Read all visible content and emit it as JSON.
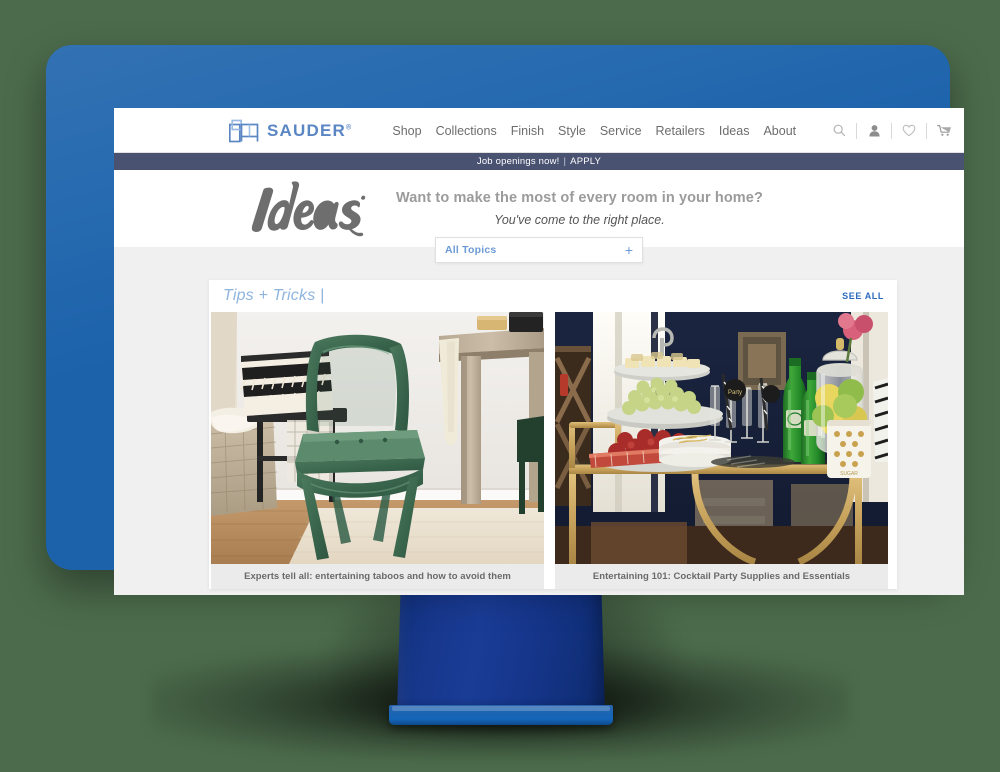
{
  "background_color": "#4c6b4c",
  "monitor": {
    "bezel_color": "#1b62ab",
    "stand_color": "#17378c",
    "stand_base_color": "#1565b8"
  },
  "site": {
    "brand": {
      "name": "SAUDER",
      "registered_mark": "®",
      "logo_icon": "sauder-furniture-logo-icon",
      "color": "#5b86c4"
    },
    "nav": [
      {
        "label": "Shop"
      },
      {
        "label": "Collections"
      },
      {
        "label": "Finish"
      },
      {
        "label": "Style"
      },
      {
        "label": "Service"
      },
      {
        "label": "Retailers"
      },
      {
        "label": "Ideas"
      },
      {
        "label": "About"
      }
    ],
    "header_icons": [
      {
        "name": "search-icon"
      },
      {
        "name": "account-icon"
      },
      {
        "name": "wishlist-heart-icon"
      },
      {
        "name": "shopping-cart-icon"
      }
    ],
    "announcement": {
      "text": "Job openings now!",
      "separator": "|",
      "link_label": "APPLY",
      "background_color": "#4a5272"
    },
    "hero": {
      "logo_word": "Ideas",
      "headline": "Want to make the most of every room in your home?",
      "subhead": "You've come to the right place."
    },
    "topics_filter": {
      "label": "All Topics",
      "expand_icon": "plus-icon",
      "accent_color": "#6b9ad4"
    },
    "section": {
      "title": "Tips + Tricks |",
      "see_all_label": "SEE ALL",
      "title_color": "#8fb4de",
      "see_all_color": "#2c6bbd",
      "cards": [
        {
          "caption": "Experts tell all: entertaining taboos and how to avoid them",
          "image_alt": "Dining room with green metal Tolix chair, weathered wood table, woven basket and striped throw pillows"
        },
        {
          "caption": "Entertaining 101: Cocktail Party Supplies and Essentials",
          "image_alt": "Gold bar cart styled with tiered dessert stand, grapes, strawberries, green mineral water bottles and glass apothecary jar"
        }
      ]
    }
  }
}
